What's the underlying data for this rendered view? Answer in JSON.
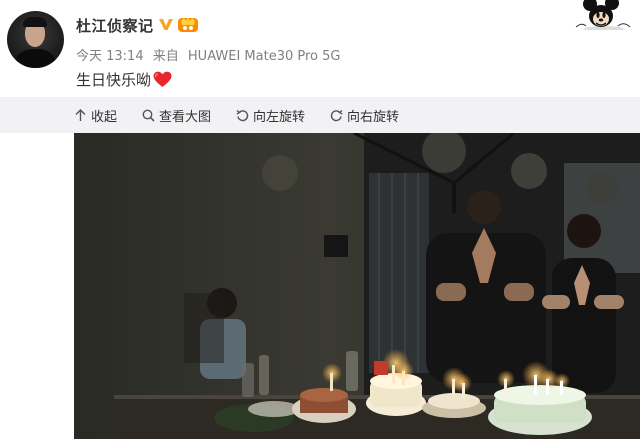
{
  "post": {
    "author_name": "杜江侦察记",
    "time": "今天 13:14",
    "source_prefix": "来自",
    "device": "HUAWEI Mate30 Pro 5G",
    "text": "生日快乐呦"
  },
  "toolbar": {
    "collapse_label": "收起",
    "view_large_label": "查看大图",
    "rotate_left_label": "向左旋转",
    "rotate_right_label": "向右旋转"
  },
  "icons": {
    "verified": "verified-v-icon",
    "level": "member-level-icon",
    "heart": "red-heart-emoji",
    "mascot": "mickey-mouse-icon",
    "collapse": "arrow-up-icon",
    "zoom": "magnifier-icon",
    "rotate_left": "rotate-left-icon",
    "rotate_right": "rotate-right-icon"
  },
  "colors": {
    "verified": "#f5a623",
    "heart": "#e8262e",
    "toolbar_bg": "#f2f2f5",
    "meta_text": "#808080"
  },
  "photo": {
    "subject": "birthday-cake-celebration-photo"
  }
}
